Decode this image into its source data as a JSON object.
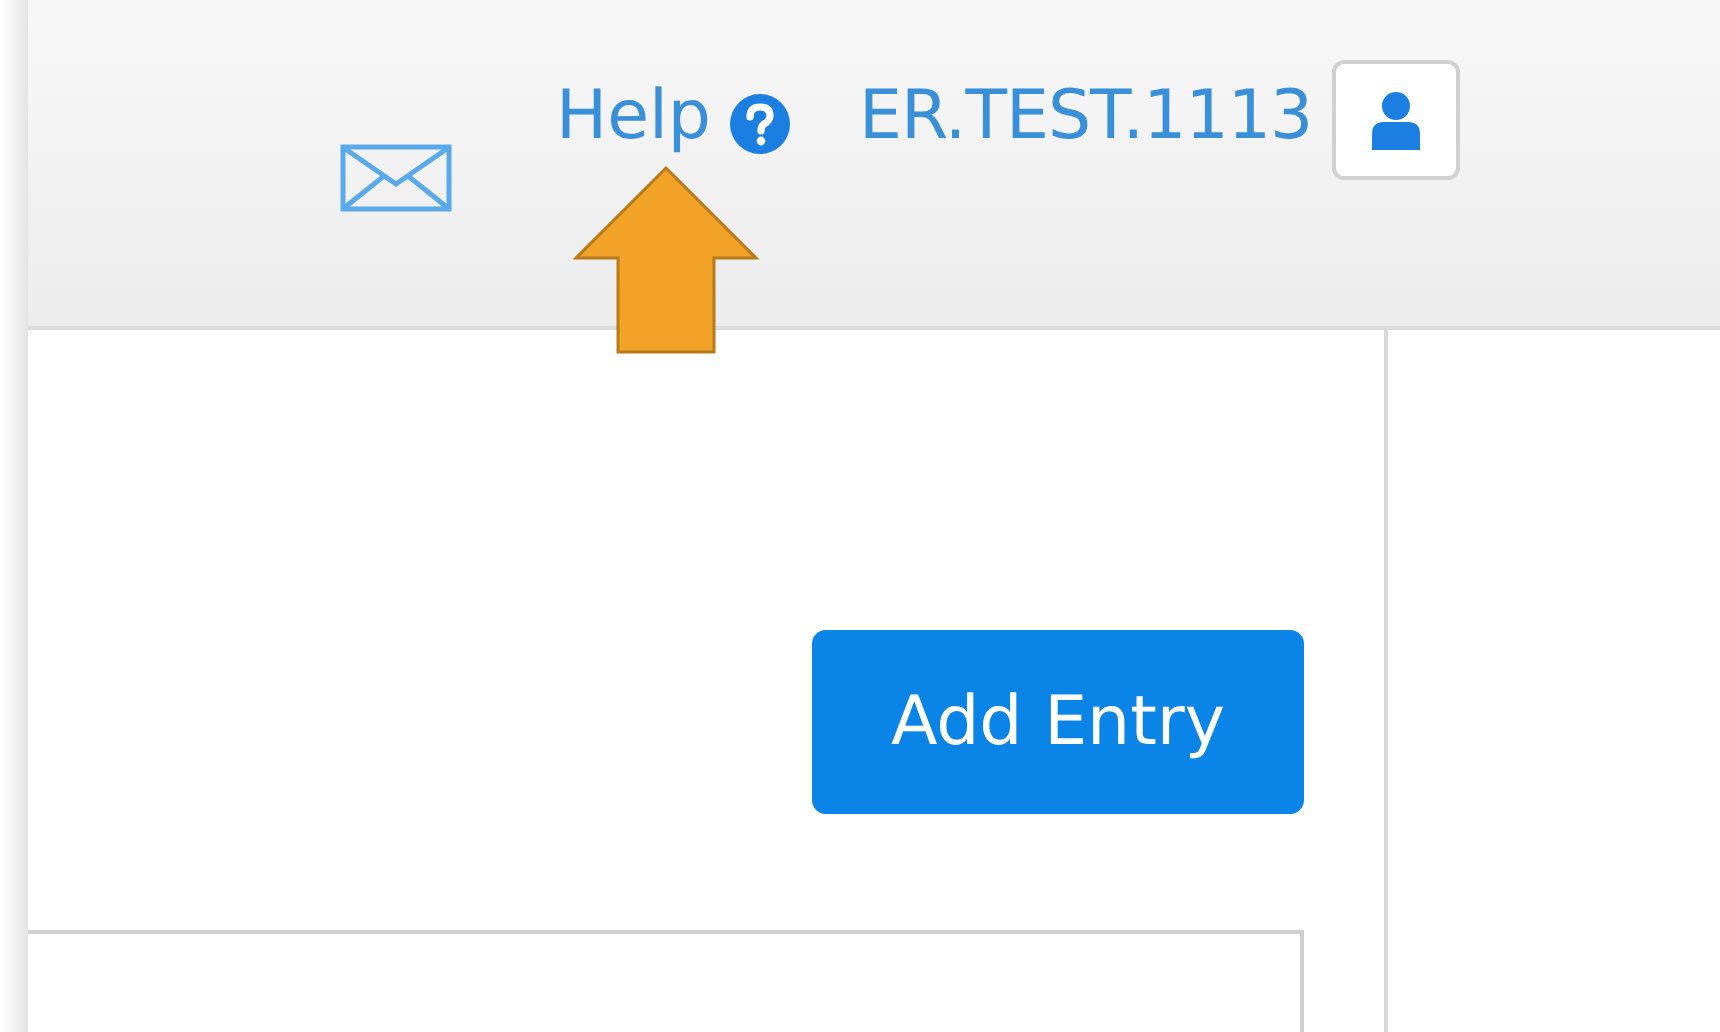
{
  "header": {
    "help_link": "Help",
    "username": "ER.TEST.1113"
  },
  "content": {
    "add_button": "Add Entry"
  }
}
